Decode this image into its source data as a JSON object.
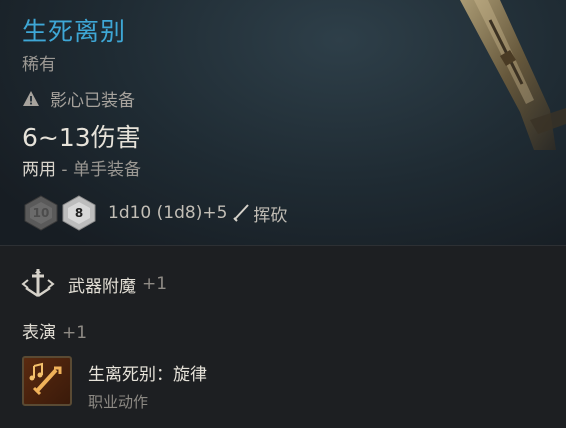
{
  "item": {
    "name": "生死离别",
    "rarity": "稀有",
    "equip_status": "影心已装备",
    "damage_range": "6~13伤害",
    "hand": "两用",
    "hand_sep": " - ",
    "hand_sub": "单手装备"
  },
  "dice": [
    {
      "icon": "d10-dim-die-icon",
      "label": "10"
    },
    {
      "icon": "d8-die-icon",
      "label": "8"
    }
  ],
  "damage": {
    "formula": "1d10 (1d8)+5",
    "type_icon": "slashing-icon",
    "type": "挥砍"
  },
  "enchant": {
    "icon": "weapon-enchant-icon",
    "label": "武器附魔",
    "value": "+1"
  },
  "performance": {
    "label": "表演",
    "value": "+1"
  },
  "action": {
    "icon": "music-sword-icon",
    "name": "生离死别：旋律",
    "sub": "职业动作"
  },
  "colors": {
    "name": "#3ea7d6",
    "header_bg": "#1f2b33",
    "section_bg": "#1d1f22"
  }
}
